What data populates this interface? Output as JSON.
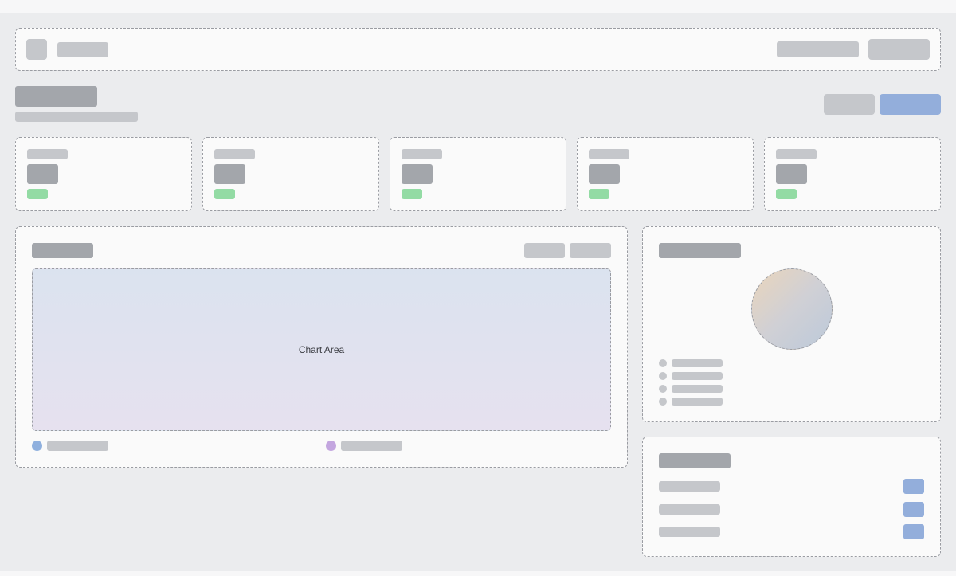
{
  "chart": {
    "area_label": "Chart Area"
  },
  "colors": {
    "page_background": "#ebecee",
    "panel_background": "#fafafa",
    "placeholder_light": "#c2c4c8",
    "placeholder_dark": "#a3a6ab",
    "positive_badge": "#93dba4",
    "primary_accent": "#93aedb",
    "legend_series_1": "#8fb0de",
    "legend_series_2": "#c3a6df"
  }
}
